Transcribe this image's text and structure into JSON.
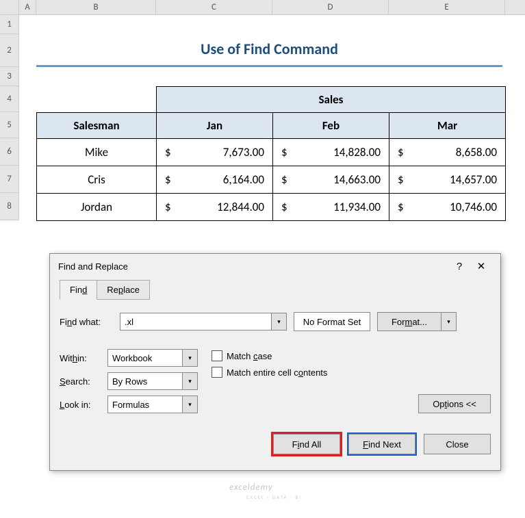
{
  "columns": [
    "A",
    "B",
    "C",
    "D",
    "E"
  ],
  "rows": [
    "1",
    "2",
    "3",
    "4",
    "5",
    "6",
    "7",
    "8"
  ],
  "title": "Use of Find Command",
  "table": {
    "sales_header": "Sales",
    "salesman_header": "Salesman",
    "months": [
      "Jan",
      "Feb",
      "Mar"
    ],
    "currency": "$",
    "data": [
      {
        "name": "Mike",
        "vals": [
          "7,673.00",
          "14,828.00",
          "8,658.00"
        ]
      },
      {
        "name": "Cris",
        "vals": [
          "6,164.00",
          "14,663.00",
          "14,657.00"
        ]
      },
      {
        "name": "Jordan",
        "vals": [
          "12,844.00",
          "11,934.00",
          "10,746.00"
        ]
      }
    ]
  },
  "dialog": {
    "title": "Find and Replace",
    "help": "?",
    "close": "✕",
    "tabs": {
      "find": "Find",
      "replace": "Replace"
    },
    "find_what_label": "Find what:",
    "find_what_value": ".xl",
    "no_format": "No Format Set",
    "format_btn": "Format...",
    "within_label": "Within:",
    "within_value": "Workbook",
    "search_label": "Search:",
    "search_value": "By Rows",
    "lookin_label": "Look in:",
    "lookin_value": "Formulas",
    "match_case": "Match case",
    "match_entire": "Match entire cell contents",
    "options_btn": "Options <<",
    "find_all": "Find All",
    "find_next": "Find Next",
    "close_btn": "Close"
  },
  "watermark": "exceldemy",
  "watermark_sub": "EXCEL · DATA · BI"
}
